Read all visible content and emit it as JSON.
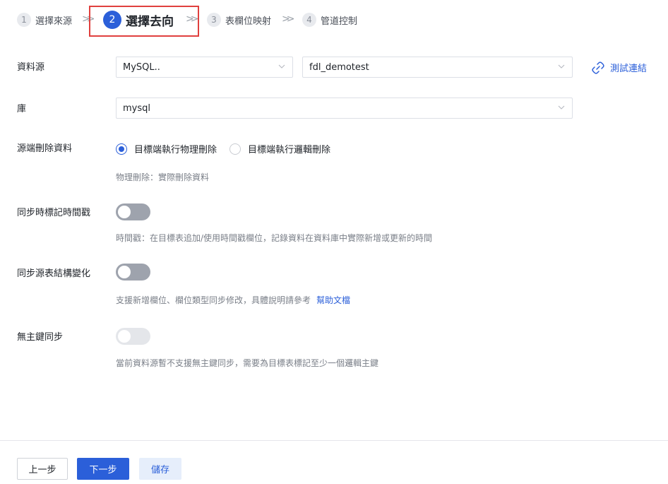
{
  "steps": [
    {
      "num": "1",
      "label": "選擇來源"
    },
    {
      "num": "2",
      "label": "選擇去向"
    },
    {
      "num": "3",
      "label": "表欄位映射"
    },
    {
      "num": "4",
      "label": "管道控制"
    }
  ],
  "form": {
    "datasource": {
      "label": "資料源",
      "type_value": "MySQL..",
      "conn_value": "fdl_demotest",
      "test_label": "測試連結"
    },
    "database": {
      "label": "庫",
      "value": "mysql"
    },
    "source_delete": {
      "label": "源端刪除資料",
      "option_physical": "目標端執行物理刪除",
      "option_logical": "目標端執行邏輯刪除",
      "selected": "physical",
      "hint": "物理刪除：實際刪除資料"
    },
    "sync_timestamp": {
      "label": "同步時標記時間戳",
      "enabled": false,
      "hint": "時間戳：在目標表追加/使用時間戳欄位，記錄資料在資料庫中實際新增或更新的時間"
    },
    "sync_schema": {
      "label": "同步源表結構變化",
      "enabled": false,
      "hint": "支援新增欄位、欄位類型同步修改，具體說明請參考",
      "doc_link": "幫助文檔"
    },
    "no_pk_sync": {
      "label": "無主鍵同步",
      "enabled": false,
      "disabled": true,
      "hint": "當前資料源暫不支援無主鍵同步，需要為目標表標記至少一個邏輯主鍵"
    }
  },
  "footer": {
    "prev": "上一步",
    "next": "下一步",
    "save": "儲存"
  },
  "colors": {
    "primary": "#2b5fd9",
    "highlight_box": "#e0403e"
  }
}
